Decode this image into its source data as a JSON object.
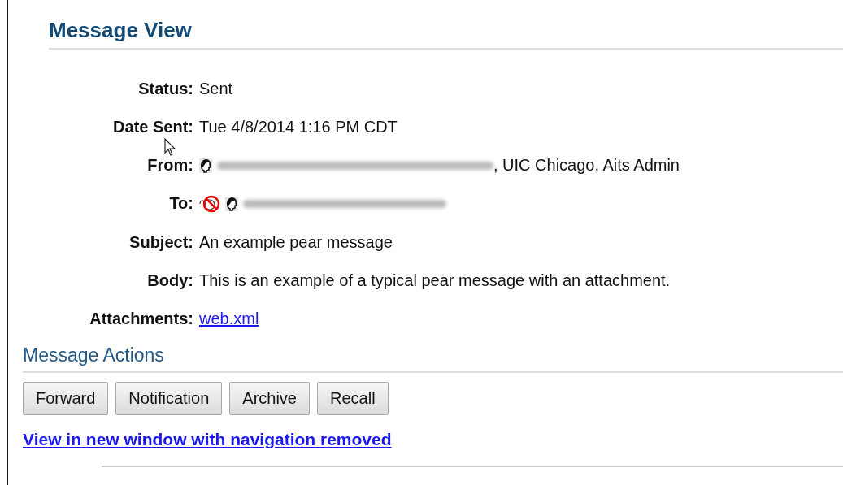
{
  "title": "Message View",
  "fields": [
    {
      "label": "Status:",
      "kind": "text",
      "value": "Sent"
    },
    {
      "label": "Date Sent:",
      "kind": "text",
      "value": "Tue 4/8/2014 1:16 PM CDT"
    },
    {
      "label": "From:",
      "kind": "person",
      "value": ", UIC Chicago, Aits Admin"
    },
    {
      "label": "To:",
      "kind": "blocked_person"
    },
    {
      "label": "Subject:",
      "kind": "text",
      "value": "An example pear message"
    },
    {
      "label": "Body:",
      "kind": "text",
      "value": "This is an example of a typical pear message with an attachment."
    },
    {
      "label": "Attachments:",
      "kind": "link",
      "value": "web.xml"
    }
  ],
  "actions": {
    "heading": "Message Actions",
    "buttons": [
      "Forward",
      "Notification",
      "Archive",
      "Recall"
    ]
  },
  "bottom_link": "View in new window with navigation removed"
}
